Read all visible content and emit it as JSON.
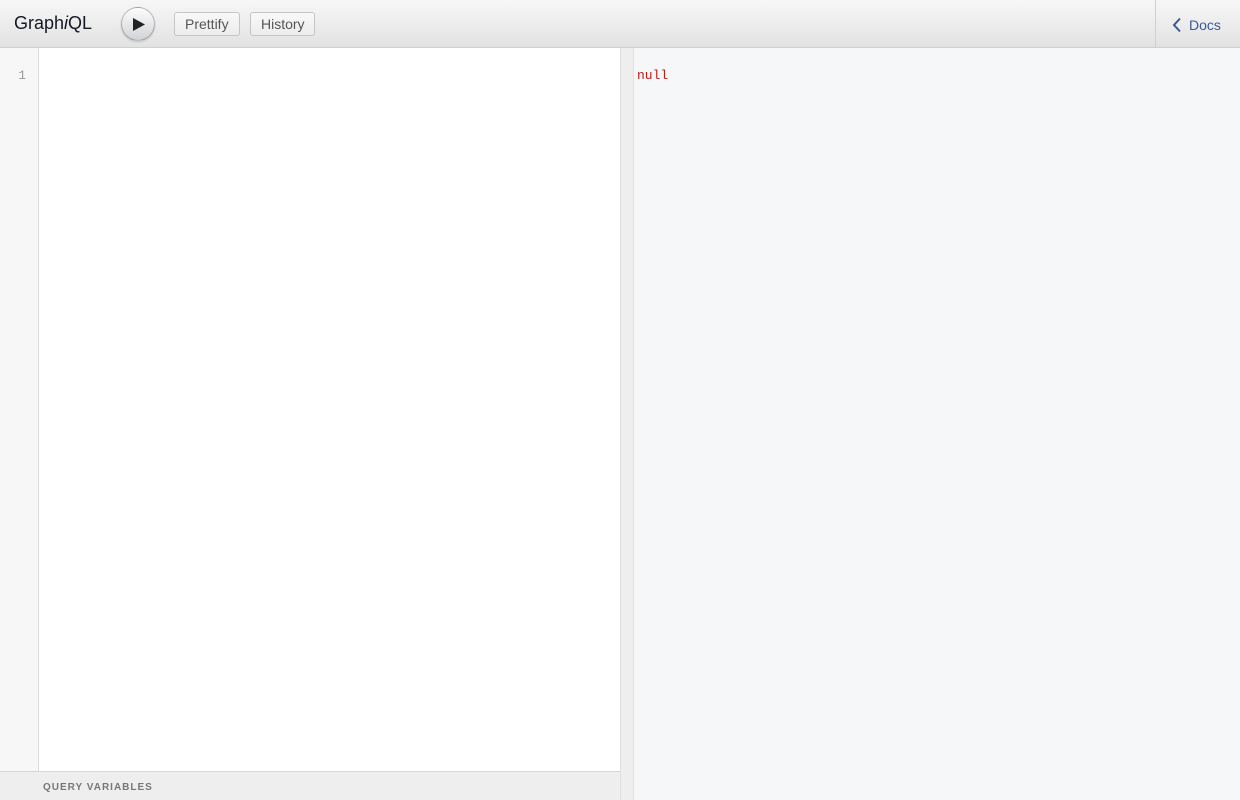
{
  "app": {
    "title_prefix": "Graph",
    "title_italic": "i",
    "title_suffix": "QL"
  },
  "toolbar": {
    "run_icon": "play-icon",
    "prettify_label": "Prettify",
    "history_label": "History"
  },
  "docs": {
    "icon": "chevron-left-icon",
    "label": "Docs",
    "color": "#3b5998"
  },
  "editor": {
    "line_numbers": [
      "1"
    ],
    "query": ""
  },
  "variables": {
    "label": "QUERY VARIABLES"
  },
  "result": {
    "text": "null",
    "color": "#c41a16"
  }
}
